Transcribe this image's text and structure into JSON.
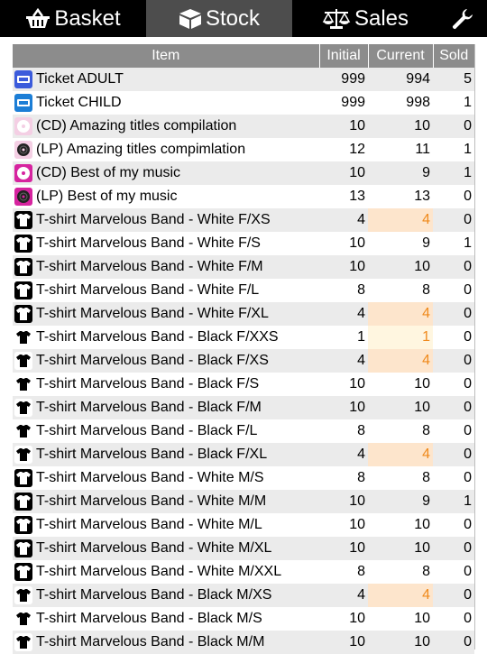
{
  "nav": {
    "tabs": [
      {
        "label": "Basket",
        "icon": "basket-icon"
      },
      {
        "label": "Stock",
        "icon": "box-icon",
        "active": true
      },
      {
        "label": "Sales",
        "icon": "scale-icon"
      }
    ],
    "settings_icon": "wrench-icon"
  },
  "colors": {
    "topbar": "#000000",
    "active_tab": "#4d4d4d",
    "header_bg": "#8c8c8c",
    "row_alt": "#ebebeb",
    "low_stock_bg": "#fde5cc",
    "low_stock_text": "#f08a1c"
  },
  "table": {
    "headers": {
      "item": "Item",
      "initial": "Initial",
      "current": "Current",
      "sold": "Sold"
    },
    "rows": [
      {
        "icon": "ticket-adult-icon",
        "item": "Ticket ADULT",
        "initial": "999",
        "current": "994",
        "sold": "5",
        "flag": ""
      },
      {
        "icon": "ticket-child-icon",
        "item": "Ticket CHILD",
        "initial": "999",
        "current": "998",
        "sold": "1",
        "flag": ""
      },
      {
        "icon": "cd-icon",
        "item": "(CD) Amazing titles compilation",
        "initial": "10",
        "current": "10",
        "sold": "0",
        "flag": ""
      },
      {
        "icon": "lp-icon",
        "item": "(LP) Amazing titles compimlation",
        "initial": "12",
        "current": "11",
        "sold": "1",
        "flag": ""
      },
      {
        "icon": "cd-pink-icon",
        "item": "(CD) Best of my music",
        "initial": "10",
        "current": "9",
        "sold": "1",
        "flag": ""
      },
      {
        "icon": "lp-pink-icon",
        "item": "(LP) Best of my music",
        "initial": "13",
        "current": "13",
        "sold": "0",
        "flag": ""
      },
      {
        "icon": "tshirt-white-xs-icon",
        "item": "T-shirt Marvelous Band - White F/XS",
        "initial": "4",
        "current": "4",
        "sold": "0",
        "flag": "low"
      },
      {
        "icon": "tshirt-white-s-icon",
        "item": "T-shirt Marvelous Band - White F/S",
        "initial": "10",
        "current": "9",
        "sold": "1",
        "flag": ""
      },
      {
        "icon": "tshirt-white-m-icon",
        "item": "T-shirt Marvelous Band - White F/M",
        "initial": "10",
        "current": "10",
        "sold": "0",
        "flag": ""
      },
      {
        "icon": "tshirt-white-l-icon",
        "item": "T-shirt Marvelous Band - White F/L",
        "initial": "8",
        "current": "8",
        "sold": "0",
        "flag": ""
      },
      {
        "icon": "tshirt-white-xl-icon",
        "item": "T-shirt Marvelous Band - White F/XL",
        "initial": "4",
        "current": "4",
        "sold": "0",
        "flag": "low"
      },
      {
        "icon": "tshirt-black-xxs-icon",
        "item": "T-shirt Marvelous Band - Black F/XXS",
        "initial": "1",
        "current": "1",
        "sold": "0",
        "flag": "vlow"
      },
      {
        "icon": "tshirt-black-xs-icon",
        "item": "T-shirt Marvelous Band - Black F/XS",
        "initial": "4",
        "current": "4",
        "sold": "0",
        "flag": "low"
      },
      {
        "icon": "tshirt-black-s-icon",
        "item": "T-shirt Marvelous Band - Black F/S",
        "initial": "10",
        "current": "10",
        "sold": "0",
        "flag": ""
      },
      {
        "icon": "tshirt-black-m-icon",
        "item": "T-shirt Marvelous Band - Black F/M",
        "initial": "10",
        "current": "10",
        "sold": "0",
        "flag": ""
      },
      {
        "icon": "tshirt-black-l-icon",
        "item": "T-shirt Marvelous Band - Black F/L",
        "initial": "8",
        "current": "8",
        "sold": "0",
        "flag": ""
      },
      {
        "icon": "tshirt-black-xl-icon",
        "item": "T-shirt Marvelous Band - Black F/XL",
        "initial": "4",
        "current": "4",
        "sold": "0",
        "flag": "low"
      },
      {
        "icon": "tshirt-white-s-icon",
        "item": "T-shirt Marvelous Band - White M/S",
        "initial": "8",
        "current": "8",
        "sold": "0",
        "flag": ""
      },
      {
        "icon": "tshirt-white-m-icon",
        "item": "T-shirt Marvelous Band - White M/M",
        "initial": "10",
        "current": "9",
        "sold": "1",
        "flag": ""
      },
      {
        "icon": "tshirt-white-l-icon",
        "item": "T-shirt Marvelous Band - White M/L",
        "initial": "10",
        "current": "10",
        "sold": "0",
        "flag": ""
      },
      {
        "icon": "tshirt-white-xl-icon",
        "item": "T-shirt Marvelous Band - White M/XL",
        "initial": "10",
        "current": "10",
        "sold": "0",
        "flag": ""
      },
      {
        "icon": "tshirt-white-xxl-icon",
        "item": "T-shirt Marvelous Band - White M/XXL",
        "initial": "8",
        "current": "8",
        "sold": "0",
        "flag": ""
      },
      {
        "icon": "tshirt-black-xs-icon",
        "item": "T-shirt Marvelous Band - Black M/XS",
        "initial": "4",
        "current": "4",
        "sold": "0",
        "flag": "low"
      },
      {
        "icon": "tshirt-black-s-icon",
        "item": "T-shirt Marvelous Band - Black M/S",
        "initial": "10",
        "current": "10",
        "sold": "0",
        "flag": ""
      },
      {
        "icon": "tshirt-black-m-icon",
        "item": "T-shirt Marvelous Band - Black M/M",
        "initial": "10",
        "current": "10",
        "sold": "0",
        "flag": ""
      }
    ]
  }
}
